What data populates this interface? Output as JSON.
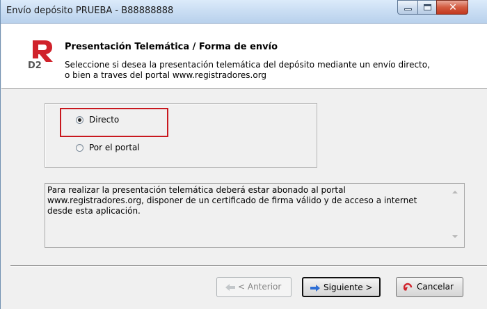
{
  "window": {
    "title": "Envío depósito PRUEBA - B88888888"
  },
  "header": {
    "title": "Presentación Telemática / Forma de envío",
    "description_line1": "Seleccione si desea la presentación telemática del depósito mediante un envío directo,",
    "description_line2": "o bien a traves del portal www.registradores.org",
    "logo_text": "D2"
  },
  "options": [
    {
      "label": "Directo",
      "selected": true
    },
    {
      "label": "Por el portal",
      "selected": false
    }
  ],
  "info": {
    "line1": "Para realizar la presentación telemática deberá estar abonado al portal",
    "line2": "www.registradores.org, disponer de un certificado de firma válido y de acceso a internet",
    "line3": "desde esta aplicación."
  },
  "buttons": {
    "anterior": "< Anterior",
    "siguiente": "Siguiente >",
    "cancelar": "Cancelar"
  },
  "colors": {
    "highlight": "#c8181e",
    "logo_red": "#d0222b",
    "arrow_blue": "#2f6fd6"
  }
}
